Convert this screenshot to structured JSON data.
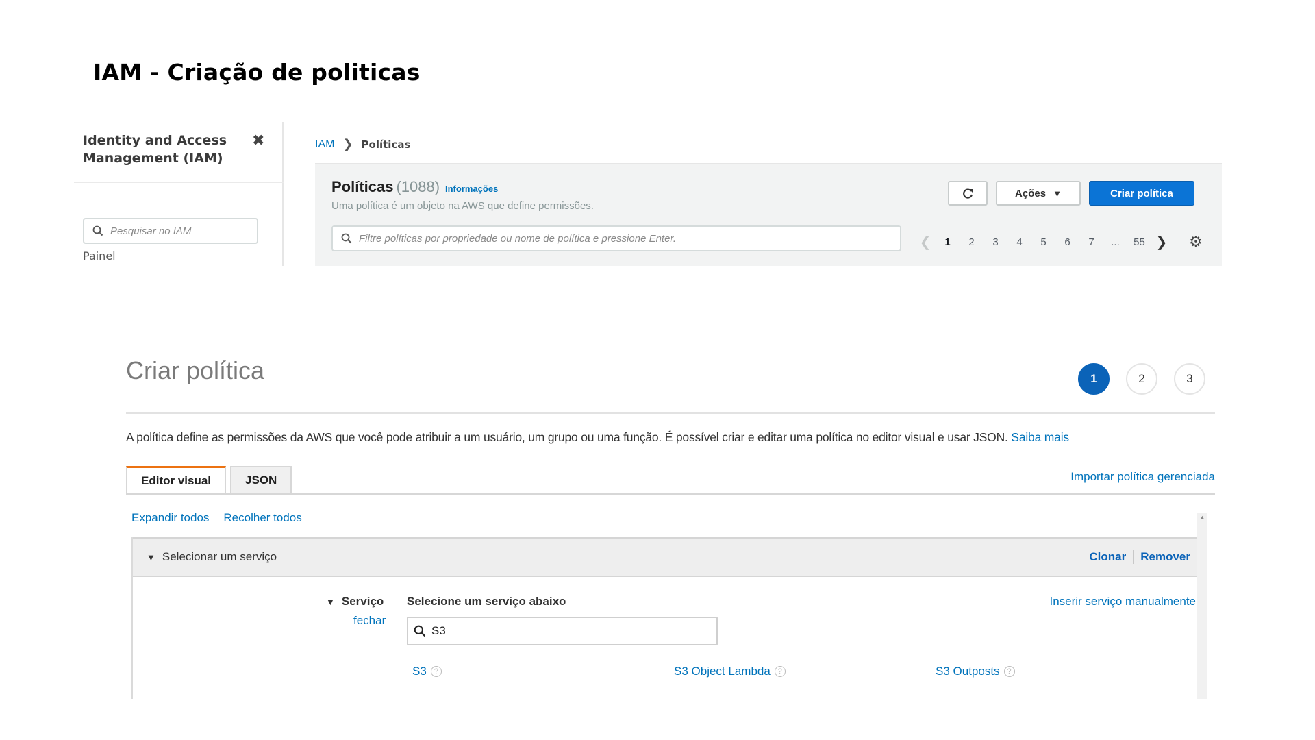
{
  "slide": {
    "title": "IAM - Criação de politicas"
  },
  "iam_console": {
    "sidebar": {
      "title": "Identity and Access Management (IAM)",
      "close_icon": "close-icon",
      "search_placeholder": "Pesquisar no IAM",
      "items": [
        {
          "label": "Painel"
        }
      ]
    },
    "breadcrumb": {
      "root": "IAM",
      "current": "Políticas"
    },
    "policies": {
      "title": "Políticas",
      "count": "(1088)",
      "info_link": "Informações",
      "description": "Uma política é um objeto na AWS que define permissões.",
      "refresh_icon": "refresh-icon",
      "actions_label": "Ações",
      "create_label": "Criar política",
      "filter_placeholder": "Filtre políticas por propriedade ou nome de política e pressione Enter.",
      "pagination": {
        "pages": [
          "1",
          "2",
          "3",
          "4",
          "5",
          "6",
          "7"
        ],
        "ellipsis": "...",
        "last": "55",
        "current": "1"
      },
      "settings_icon": "gear-icon"
    }
  },
  "create_policy": {
    "title": "Criar política",
    "steps": [
      "1",
      "2",
      "3"
    ],
    "active_step": "1",
    "description": "A política define as permissões da AWS que você pode atribuir a um usuário, um grupo ou uma função. É possível criar e editar uma política no editor visual e usar JSON.",
    "learn_more": "Saiba mais",
    "tabs": [
      {
        "label": "Editor visual",
        "active": true
      },
      {
        "label": "JSON",
        "active": false
      }
    ],
    "import_link": "Importar política gerenciada",
    "expand_all": "Expandir todos",
    "collapse_all": "Recolher todos",
    "section": {
      "header": "Selecionar um serviço",
      "clone": "Clonar",
      "remove": "Remover",
      "service_label": "Serviço",
      "close_link": "fechar",
      "prompt": "Selecione um serviço abaixo",
      "manual_link": "Inserir serviço manualmente",
      "search_value": "S3",
      "results": [
        "S3",
        "S3 Object Lambda",
        "S3 Outposts"
      ]
    }
  },
  "colors": {
    "accent_blue": "#0b74d6",
    "link_blue": "#0073bb",
    "tab_orange": "#ec7211"
  }
}
